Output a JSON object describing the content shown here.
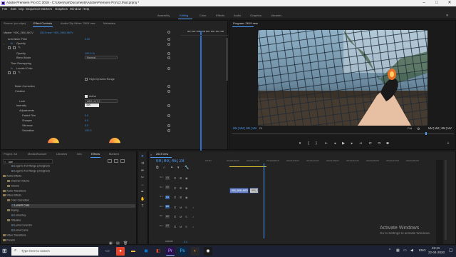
{
  "window": {
    "title": "Adobe Premiere Pro CC 2018 - C:\\Users\\sol\\Documents\\Adobe\\Premiere Pro\\12.0\\lut.prproj *",
    "minimize": "–",
    "maximize": "□",
    "close": "✕"
  },
  "menu": [
    "File",
    "Edit",
    "Clip",
    "Sequence",
    "Markers",
    "Graphics",
    "Window",
    "Help"
  ],
  "workspaces": [
    "Assembly",
    "Editing",
    "Color",
    "Effects",
    "Audio",
    "Graphics",
    "Libraries"
  ],
  "active_workspace": "Editing",
  "source_panel": {
    "tabs": [
      "Source: (no clips)",
      "Effect Controls",
      "Audio Clip Mixer: 2619 new",
      "Metadata"
    ],
    "master_label": "Master * 900_2691.MOV",
    "clip_label": "2619 new * 900_2691.MOV",
    "timecode_start": "00:00:00:00",
    "timecode_mid": "00:00:05:00",
    "rows": [
      {
        "label": "Anti-flicker Filter",
        "value": "0.00"
      },
      {
        "label": "Opacity",
        "value": ""
      },
      {
        "label": "Opacity",
        "value": "100.0 %"
      },
      {
        "label": "Blend Mode",
        "value": "Normal"
      },
      {
        "label": "Time Remapping",
        "value": ""
      },
      {
        "label": "Lumetri Color",
        "value": ""
      },
      {
        "label": "High Dynamic Range",
        "value": ""
      },
      {
        "label": "Basic Correction",
        "value": ""
      },
      {
        "label": "Creative",
        "value": ""
      },
      {
        "label": "Active",
        "value": ""
      },
      {
        "label": "Look",
        "value": "AE2 LUT 2"
      },
      {
        "label": "Intensity",
        "value": "100"
      },
      {
        "label": "Adjustments",
        "value": ""
      },
      {
        "label": "Faded Film",
        "value": "0.0"
      },
      {
        "label": "Sharpen",
        "value": "0.0"
      },
      {
        "label": "Vibrance",
        "value": "0.0"
      },
      {
        "label": "Saturation",
        "value": "100.0"
      }
    ]
  },
  "program_monitor": {
    "tab": "Program: 2619 new",
    "timecode": "00;00;46;28",
    "fit": "Fit",
    "quality": "Full",
    "duration": "00;00;48;02"
  },
  "project_panel": {
    "tabs": [
      "Project: lut",
      "Media Browser",
      "Libraries",
      "Info",
      "Effects",
      "Markers"
    ],
    "search_value": "lum",
    "tree": [
      {
        "label": "Legal to Full Range (Unsigned)",
        "level": 2,
        "selected": false
      },
      {
        "label": "Legal to Full Range (Unsigned)",
        "level": 2,
        "selected": false
      },
      {
        "label": "Audio Effects",
        "level": 0,
        "selected": false
      },
      {
        "label": "Channel Volume",
        "level": 1,
        "selected": false
      },
      {
        "label": "Volume",
        "level": 1,
        "selected": false
      },
      {
        "label": "Audio Transitions",
        "level": 0,
        "selected": false
      },
      {
        "label": "Video Effects",
        "level": 0,
        "selected": false
      },
      {
        "label": "Color Correction",
        "level": 1,
        "selected": false
      },
      {
        "label": "Lumetri Color",
        "level": 2,
        "selected": true
      },
      {
        "label": "Keying",
        "level": 1,
        "selected": false
      },
      {
        "label": "Luma Key",
        "level": 2,
        "selected": false
      },
      {
        "label": "Obsolete",
        "level": 1,
        "selected": false
      },
      {
        "label": "Luma Corrector",
        "level": 2,
        "selected": false
      },
      {
        "label": "Luma Curve",
        "level": 2,
        "selected": false
      },
      {
        "label": "Video Transitions",
        "level": 0,
        "selected": false
      },
      {
        "label": "Presets",
        "level": 0,
        "selected": false
      }
    ]
  },
  "timeline": {
    "tab": "2619 new",
    "timecode": "00;00;46;28",
    "ruler": [
      "00;00",
      "00;00;16;00",
      "00;00;32;00",
      "00;00;48;00",
      "00;01;04;02",
      "00;01;20;02",
      "00;01;36;02",
      "00;01;52;02",
      "00;02;08;04",
      "00;02;24;04",
      "00;02;40;04"
    ],
    "video_tracks": [
      "V3",
      "V2",
      "V1"
    ],
    "audio_tracks": [
      "A1",
      "A2",
      "A3"
    ],
    "master_label": "Master",
    "master_value": "0.0",
    "clips": [
      {
        "label": "900_2691.MOV",
        "track": "V1",
        "start": 0,
        "end": 16
      },
      {
        "label": "900_2691.MOV",
        "track": "V1",
        "start": 16,
        "end": 24
      }
    ]
  },
  "activate_windows": {
    "title": "Activate Windows",
    "subtitle": "Go to Settings to activate Windows."
  },
  "taskbar": {
    "search_placeholder": "Type here to search",
    "clock_time": "22:41",
    "clock_date": "22-04-2020",
    "lang": "ENG"
  },
  "colors": {
    "accent": "#4b9cff",
    "clip": "#6d87c9",
    "panel": "#232323",
    "taskbar": "#1c2233"
  }
}
